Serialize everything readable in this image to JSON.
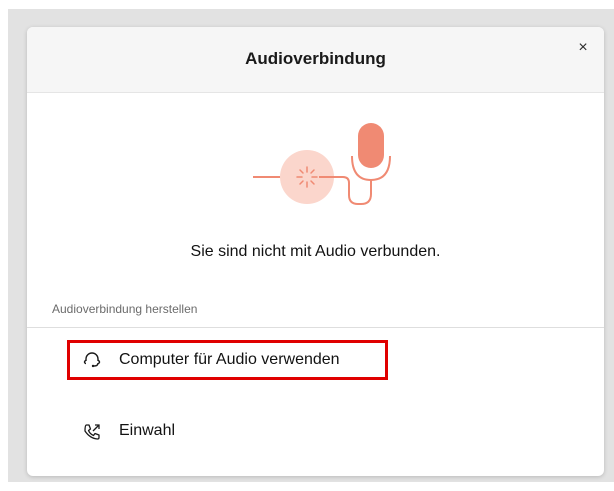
{
  "dialog": {
    "title": "Audioverbindung",
    "close_label": "×",
    "status_text": "Sie sind nicht mit Audio verbunden.",
    "section_label": "Audioverbindung herstellen",
    "options": [
      {
        "label": "Computer für Audio verwenden",
        "icon": "headset-icon",
        "highlighted": true
      },
      {
        "label": "Einwahl",
        "icon": "phone-callout-icon",
        "highlighted": false
      }
    ]
  },
  "colors": {
    "accent_coral": "#f08a73",
    "accent_coral_light": "#fbd6cc",
    "highlight_red": "#e00000",
    "header_bg": "#f6f6f6",
    "backdrop": "#e2e2e2"
  }
}
